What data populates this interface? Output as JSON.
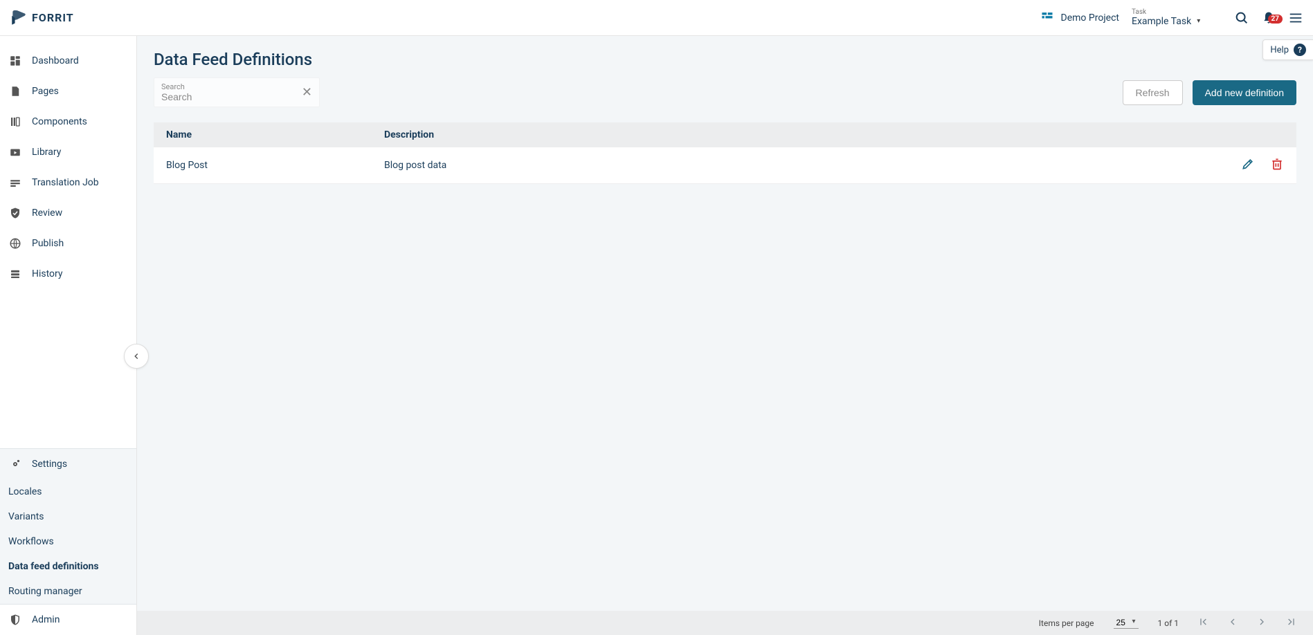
{
  "brand": "FORRIT",
  "header": {
    "project_label": "Demo Project",
    "task_caption": "Task",
    "task_value": "Example Task",
    "notif_count": "27"
  },
  "help_label": "Help",
  "sidebar": {
    "main": [
      {
        "label": "Dashboard",
        "icon": "dashboard"
      },
      {
        "label": "Pages",
        "icon": "pages"
      },
      {
        "label": "Components",
        "icon": "components"
      },
      {
        "label": "Library",
        "icon": "library"
      },
      {
        "label": "Translation Job",
        "icon": "translation"
      },
      {
        "label": "Review",
        "icon": "review"
      },
      {
        "label": "Publish",
        "icon": "publish"
      },
      {
        "label": "History",
        "icon": "history"
      }
    ],
    "settings_label": "Settings",
    "settings_sub": [
      {
        "label": "Locales",
        "active": false
      },
      {
        "label": "Variants",
        "active": false
      },
      {
        "label": "Workflows",
        "active": false
      },
      {
        "label": "Data feed definitions",
        "active": true
      },
      {
        "label": "Routing manager",
        "active": false
      }
    ],
    "admin_label": "Admin"
  },
  "page": {
    "title": "Data Feed Definitions",
    "search_label": "Search",
    "search_placeholder": "Search",
    "refresh_label": "Refresh",
    "add_label": "Add new definition"
  },
  "table": {
    "col_name": "Name",
    "col_desc": "Description",
    "rows": [
      {
        "name": "Blog Post",
        "description": "Blog post data"
      }
    ]
  },
  "paginator": {
    "items_per_page_label": "Items per page",
    "items_per_page_value": "25",
    "range_text": "1 of 1"
  }
}
